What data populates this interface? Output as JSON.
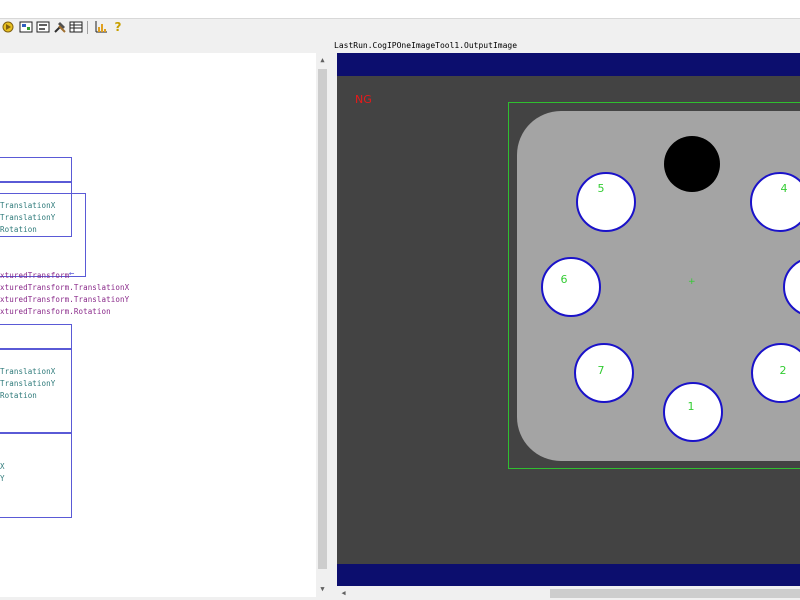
{
  "toolbar": {
    "icons": [
      "run-icon",
      "image-icon",
      "image-icon-2",
      "tools-icon",
      "table-icon",
      "chart-icon",
      "help-icon"
    ],
    "help_glyph": "?"
  },
  "diagram": {
    "lines": [
      {
        "text": "TranslationX",
        "color": "teal"
      },
      {
        "text": "TranslationY",
        "color": "teal"
      },
      {
        "text": "Rotation",
        "color": "teal"
      },
      {
        "text": "xturedTransform",
        "color": "purple"
      },
      {
        "text": "xturedTransform.TranslationX",
        "color": "purple"
      },
      {
        "text": "xturedTransform.TranslationY",
        "color": "purple"
      },
      {
        "text": "xturedTransform.Rotation",
        "color": "purple"
      },
      {
        "text": "TranslationX",
        "color": "teal"
      },
      {
        "text": "TranslationY",
        "color": "teal"
      },
      {
        "text": "Rotation",
        "color": "teal"
      },
      {
        "text": "X",
        "color": "teal"
      },
      {
        "text": "Y",
        "color": "teal"
      }
    ],
    "arrow_glyph": "←"
  },
  "image_view": {
    "header": "LastRun.CogIPOneImageTool1.OutputImage",
    "status": "NG",
    "center_mark": "+",
    "holes": [
      "5",
      "4",
      "6",
      "7",
      "2",
      "1"
    ],
    "colors": {
      "band": "#0c0e6e",
      "background": "#434343",
      "part": "#a4a4a4",
      "roi": "#2fbf2f",
      "hole_outline": "#1a12c9",
      "label": "#33cc33",
      "status": "#e81a1a"
    }
  },
  "scrollbars": {
    "up_glyph": "▲",
    "down_glyph": "▼",
    "left_glyph": "◀"
  }
}
